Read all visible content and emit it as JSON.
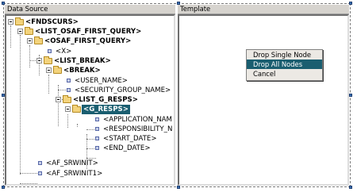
{
  "panels": {
    "data_source": "Data Source",
    "template": "Template"
  },
  "tree": [
    {
      "label": "<FNDSCURS>",
      "bold": true
    },
    {
      "label": "<LIST_OSAF_FIRST_QUERY>",
      "bold": true
    },
    {
      "label": "<OSAF_FIRST_QUERY>",
      "bold": true
    },
    {
      "label": "<X>",
      "bold": false
    },
    {
      "label": "<LIST_BREAK>",
      "bold": true
    },
    {
      "label": "<BREAK>",
      "bold": true
    },
    {
      "label": "<USER_NAME>",
      "bold": false
    },
    {
      "label": "<SECURITY_GROUP_NAME>",
      "bold": false
    },
    {
      "label": "<LIST_G_RESPS>",
      "bold": true
    },
    {
      "label": "<G_RESPS>",
      "bold": true,
      "selected": true
    },
    {
      "label": "<APPLICATION_NAM",
      "bold": false
    },
    {
      "label": "<RESPONSIBILITY_N",
      "bold": false
    },
    {
      "label": "<START_DATE>",
      "bold": false
    },
    {
      "label": "<END_DATE>",
      "bold": false
    },
    {
      "label": "<AF_SRWINIT>",
      "bold": false
    },
    {
      "label": "<AF_SRWINIT1>",
      "bold": false
    }
  ],
  "context_menu": {
    "items": [
      "Drop Single Node",
      "Drop All Nodes",
      "Cancel"
    ],
    "highlighted_index": 1
  },
  "colors": {
    "selection": "#1a5e70",
    "folder": "#f3d37c"
  }
}
